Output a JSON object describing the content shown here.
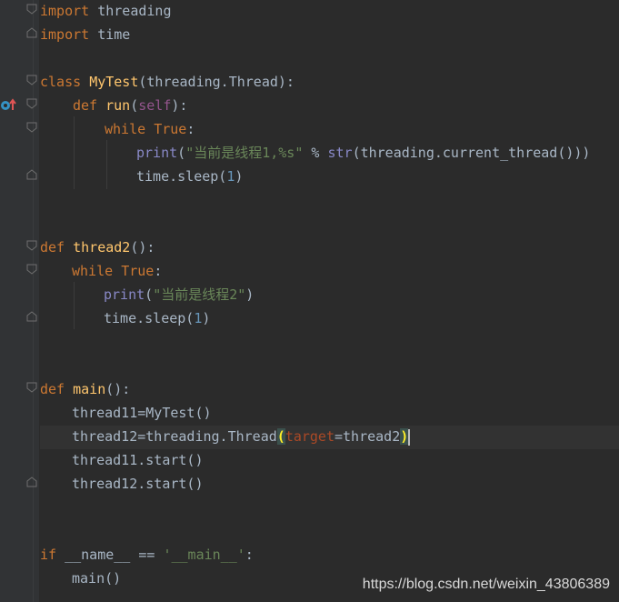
{
  "editor": {
    "lines": {
      "l1": {
        "kw": "import",
        "rest": " threading"
      },
      "l2": {
        "kw": "import",
        "rest": " time"
      },
      "l4": {
        "kw": "class",
        "name": "MyTest",
        "rest": "(threading.Thread):"
      },
      "l5": {
        "kw": "def",
        "name": "run",
        "p1": "(",
        "self": "self",
        "p2": "):"
      },
      "l6": {
        "kw": "while",
        "kw2": "True",
        "rest": ":"
      },
      "l7": {
        "builtin": "print",
        "p1": "(",
        "str": "\"当前是线程1,%s\"",
        "mid": " % ",
        "builtin2": "str",
        "rest": "(threading.current_thread()))"
      },
      "l8": {
        "text": "time.sleep(",
        "num": "1",
        "end": ")"
      },
      "l11": {
        "kw": "def",
        "name": "thread2",
        "rest": "():"
      },
      "l12": {
        "kw": "while",
        "kw2": "True",
        "rest": ":"
      },
      "l13": {
        "builtin": "print",
        "p1": "(",
        "str": "\"当前是线程2\"",
        "end": ")"
      },
      "l14": {
        "text": "time.sleep(",
        "num": "1",
        "end": ")"
      },
      "l17": {
        "kw": "def",
        "name": "main",
        "rest": "():"
      },
      "l18": {
        "text": "thread11=MyTest()"
      },
      "l19": {
        "text": "thread12=threading.Thread",
        "po": "(",
        "kwarg": "target",
        "mid": "=thread2",
        "pc": ")"
      },
      "l20": {
        "text": "thread11.start()"
      },
      "l21": {
        "text": "thread12.start()"
      },
      "l24": {
        "kw": "if",
        "sp": " ",
        "d1": "__name__",
        "mid": " == ",
        "str": "'__main__'",
        "end": ":"
      },
      "l25": {
        "text": "main()"
      }
    }
  },
  "watermark": "https://blog.csdn.net/weixin_43806389",
  "colors": {
    "background": "#2b2b2b",
    "keyword": "#cc7832",
    "function_name": "#ffc66d",
    "string": "#6a8759",
    "number": "#6897bb",
    "builtin": "#8888c6",
    "self": "#94558d"
  },
  "icons": {
    "gutter_run": "run-override-icon",
    "fold": "fold-marker-icon"
  }
}
